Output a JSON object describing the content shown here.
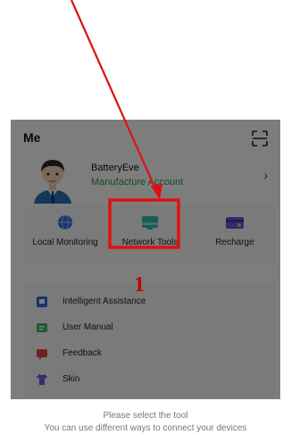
{
  "header": {
    "title": "Me",
    "scan_icon": "scan-icon"
  },
  "profile": {
    "name": "BatteryEve",
    "account_type": "Manufacture Account",
    "chevron": "›"
  },
  "tools": [
    {
      "label": "Local Monitoring",
      "icon": "globe-icon"
    },
    {
      "label": "Network Tools",
      "icon": "network-tools-icon"
    },
    {
      "label": "Recharge",
      "icon": "recharge-icon"
    }
  ],
  "menu": [
    {
      "label": "Intelligent Assistance",
      "icon": "assistant-icon"
    },
    {
      "label": "User Manual",
      "icon": "manual-icon"
    },
    {
      "label": "Feedback",
      "icon": "feedback-icon"
    },
    {
      "label": "Skin",
      "icon": "skin-icon"
    }
  ],
  "sheet": {
    "title": "Please select the tool",
    "subtitle": "You can use different ways to connect your devices"
  },
  "annotation": {
    "step_number": "1",
    "color": "#e01010"
  }
}
